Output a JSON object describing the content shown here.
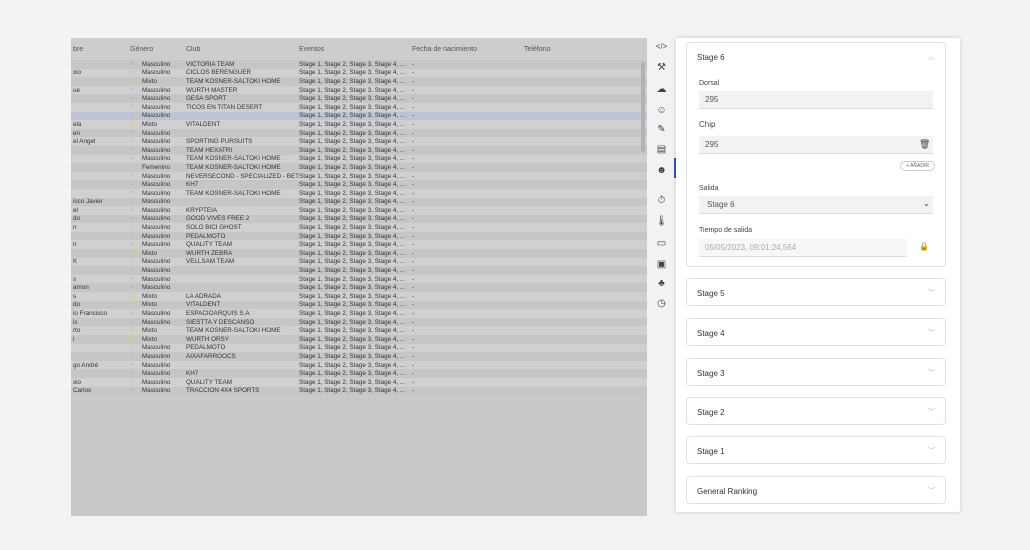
{
  "table": {
    "headers": {
      "name": "bre",
      "gender": "Género",
      "club": "Club",
      "events": "Eventos",
      "birth": "Fecha de nacimiento",
      "phone": "Teléfono"
    },
    "rows": [
      {
        "name": "",
        "g": "♂",
        "gender": "Masculino",
        "club": "VICTORIA TEAM",
        "events": "Stage 1, Stage 2, Stage 3, Stage 4, ...",
        "birth": "-"
      },
      {
        "name": "xio",
        "g": "♂",
        "gender": "Masculino",
        "club": "CICLOS BERENGUER",
        "events": "Stage 1, Stage 2, Stage 3, Stage 4, ...",
        "birth": "-"
      },
      {
        "name": "",
        "g": "⚥",
        "gender": "Mixto",
        "club": "TEAM KOSNER-SALTOKI HOME",
        "events": "Stage 1, Stage 2, Stage 3, Stage 4, ...",
        "birth": "-"
      },
      {
        "name": "ue",
        "g": "♂",
        "gender": "Masculino",
        "club": "WÜRTH MASTER",
        "events": "Stage 1, Stage 2, Stage 3, Stage 4, ...",
        "birth": "-"
      },
      {
        "name": "",
        "g": "♂",
        "gender": "Masculino",
        "club": "GESA SPORT",
        "events": "Stage 1, Stage 2, Stage 3, Stage 4, ...",
        "birth": "-"
      },
      {
        "name": "",
        "g": "♂",
        "gender": "Masculino",
        "club": "TICOS EN TITAN DESERT",
        "events": "Stage 1, Stage 2, Stage 3, Stage 4, ...",
        "birth": "-"
      },
      {
        "name": "",
        "g": "♂",
        "gender": "Masculino",
        "club": "",
        "events": "Stage 1, Stage 2, Stage 3, Stage 4, ...",
        "birth": "-",
        "sel": true
      },
      {
        "name": "ela",
        "g": "⚥",
        "gender": "Mixto",
        "club": "VITALDENT",
        "events": "Stage 1, Stage 2, Stage 3, Stage 4, ...",
        "birth": "-"
      },
      {
        "name": "en",
        "g": "♂",
        "gender": "Masculino",
        "club": "",
        "events": "Stage 1, Stage 2, Stage 3, Stage 4, ...",
        "birth": "-"
      },
      {
        "name": "el Angel",
        "g": "♂",
        "gender": "Masculino",
        "club": "SPORTING PURSUITS",
        "events": "Stage 1, Stage 2, Stage 3, Stage 4, ...",
        "birth": "-"
      },
      {
        "name": "",
        "g": "♂",
        "gender": "Masculino",
        "club": "TEAM HEXATRI",
        "events": "Stage 1, Stage 2, Stage 3, Stage 4, ...",
        "birth": "-"
      },
      {
        "name": "",
        "g": "♂",
        "gender": "Masculino",
        "club": "TEAM KOSNER-SALTOKI HOME",
        "events": "Stage 1, Stage 2, Stage 3, Stage 4, ...",
        "birth": "-"
      },
      {
        "name": "",
        "g": "♀",
        "gender": "Femenino",
        "club": "TEAM KOSNER-SALTOKI HOME",
        "events": "Stage 1, Stage 2, Stage 3, Stage 4, ...",
        "birth": "-"
      },
      {
        "name": "",
        "g": "♂",
        "gender": "Masculino",
        "club": "NEVERSECOND - SPECIALIZED - BET",
        "events": "Stage 1, Stage 2, Stage 3, Stage 4, ...",
        "birth": "-"
      },
      {
        "name": "",
        "g": "♂",
        "gender": "Masculino",
        "club": "KH7",
        "events": "Stage 1, Stage 2, Stage 3, Stage 4, ...",
        "birth": "-"
      },
      {
        "name": "",
        "g": "♂",
        "gender": "Masculino",
        "club": "TEAM KOSNER-SALTOKI HOME",
        "events": "Stage 1, Stage 2, Stage 3, Stage 4, ...",
        "birth": "-"
      },
      {
        "name": "isco Javier",
        "g": "♂",
        "gender": "Masculino",
        "club": "",
        "events": "Stage 1, Stage 2, Stage 3, Stage 4, ...",
        "birth": "-"
      },
      {
        "name": "el",
        "g": "♂",
        "gender": "Masculino",
        "club": "KRYPTEIA",
        "events": "Stage 1, Stage 2, Stage 3, Stage 4, ...",
        "birth": "-"
      },
      {
        "name": "do",
        "g": "♂",
        "gender": "Masculino",
        "club": "GOOD VIVES FREE 2",
        "events": "Stage 1, Stage 2, Stage 3, Stage 4, ...",
        "birth": "-"
      },
      {
        "name": "n",
        "g": "♂",
        "gender": "Masculino",
        "club": "SOLO BICI GHOST",
        "events": "Stage 1, Stage 2, Stage 3, Stage 4, ...",
        "birth": "-"
      },
      {
        "name": "",
        "g": "♂",
        "gender": "Masculino",
        "club": "PEDALMOTO",
        "events": "Stage 1, Stage 2, Stage 3, Stage 4, ...",
        "birth": "-"
      },
      {
        "name": "n",
        "g": "♂",
        "gender": "Masculino",
        "club": "QUALITY TEAM",
        "events": "Stage 1, Stage 2, Stage 3, Stage 4, ...",
        "birth": "-"
      },
      {
        "name": "",
        "g": "⚥",
        "gender": "Mixto",
        "club": "WÜRTH ZEBRA",
        "events": "Stage 1, Stage 2, Stage 3, Stage 4, ...",
        "birth": "-"
      },
      {
        "name": "K",
        "g": "♂",
        "gender": "Masculino",
        "club": "VELLSAM TEAM",
        "events": "Stage 1, Stage 2, Stage 3, Stage 4, ...",
        "birth": "-"
      },
      {
        "name": "",
        "g": "♂",
        "gender": "Masculino",
        "club": "",
        "events": "Stage 1, Stage 2, Stage 3, Stage 4, ...",
        "birth": "-"
      },
      {
        "name": "s",
        "g": "♂",
        "gender": "Masculino",
        "club": "",
        "events": "Stage 1, Stage 2, Stage 3, Stage 4, ...",
        "birth": "-"
      },
      {
        "name": "amon",
        "g": "♂",
        "gender": "Masculino",
        "club": "",
        "events": "Stage 1, Stage 2, Stage 3, Stage 4, ...",
        "birth": "-"
      },
      {
        "name": "s",
        "g": "⚥",
        "gender": "Mixto",
        "club": "LA ADRADA",
        "events": "Stage 1, Stage 2, Stage 3, Stage 4, ...",
        "birth": "-"
      },
      {
        "name": "do",
        "g": "⚥",
        "gender": "Mixto",
        "club": "VITALDENT",
        "events": "Stage 1, Stage 2, Stage 3, Stage 4, ...",
        "birth": "-"
      },
      {
        "name": "io Francisco",
        "g": "♂",
        "gender": "Masculino",
        "club": "ESPACIOARQUIS S.A",
        "events": "Stage 1, Stage 2, Stage 3, Stage 4, ...",
        "birth": "-"
      },
      {
        "name": "is",
        "g": "♂",
        "gender": "Masculino",
        "club": "SIESTTA Y DESCANSO",
        "events": "Stage 1, Stage 2, Stage 3, Stage 4, ...",
        "birth": "-"
      },
      {
        "name": "rto",
        "g": "⚥",
        "gender": "Mixto",
        "club": "TEAM KOSNER-SALTOKI HOME",
        "events": "Stage 1, Stage 2, Stage 3, Stage 4, ...",
        "birth": "-"
      },
      {
        "name": "i",
        "g": "⚥",
        "gender": "Mixto",
        "club": "WÜRTH ORSY",
        "events": "Stage 1, Stage 2, Stage 3, Stage 4, ...",
        "birth": "-"
      },
      {
        "name": "",
        "g": "♂",
        "gender": "Masculino",
        "club": "PEDALMOTO",
        "events": "Stage 1, Stage 2, Stage 3, Stage 4, ...",
        "birth": "-"
      },
      {
        "name": "",
        "g": "♂",
        "gender": "Masculino",
        "club": "AIXAFARROOCS",
        "events": "Stage 1, Stage 2, Stage 3, Stage 4, ...",
        "birth": "-"
      },
      {
        "name": "go André",
        "g": "♂",
        "gender": "Masculino",
        "club": "",
        "events": "Stage 1, Stage 2, Stage 3, Stage 4, ...",
        "birth": "-"
      },
      {
        "name": "",
        "g": "♂",
        "gender": "Masculino",
        "club": "KH7",
        "events": "Stage 1, Stage 2, Stage 3, Stage 4, ...",
        "birth": "-"
      },
      {
        "name": "xio",
        "g": "♂",
        "gender": "Masculino",
        "club": "QUALITY TEAM",
        "events": "Stage 1, Stage 2, Stage 3, Stage 4, ...",
        "birth": "-"
      },
      {
        "name": "Carlos",
        "g": "♂",
        "gender": "Masculino",
        "club": "TRACCIÓN 4X4 SPORTS",
        "events": "Stage 1, Stage 2, Stage 3, Stage 4, ...",
        "birth": "-"
      }
    ]
  },
  "rail": {
    "icons": [
      {
        "name": "code-icon",
        "glyph": "</>"
      },
      {
        "name": "wrench-icon",
        "glyph": "⚒"
      },
      {
        "name": "cloud-upload-icon",
        "glyph": "☁"
      },
      {
        "name": "add-user-icon",
        "glyph": "☺"
      },
      {
        "name": "edit-icon",
        "glyph": "✎"
      },
      {
        "name": "clipboard-icon",
        "glyph": "▤"
      },
      {
        "name": "users-icon",
        "glyph": "☻"
      },
      {
        "name": "stopwatch-icon",
        "glyph": "⏱"
      },
      {
        "name": "thermometer-icon",
        "glyph": "🌡"
      },
      {
        "name": "laptop-icon",
        "glyph": "▭"
      },
      {
        "name": "document-icon",
        "glyph": "▣"
      },
      {
        "name": "group-icon",
        "glyph": "♣"
      },
      {
        "name": "timer-icon",
        "glyph": "◷"
      }
    ]
  },
  "panel": {
    "expanded": {
      "title": "Stage 6",
      "dorsal_label": "Dorsal",
      "dorsal_value": "295",
      "chip_label": "Chip",
      "chip_value": "295",
      "add_label": "+ AÑADIR",
      "salida_label": "Salida",
      "salida_value": "Stage 6",
      "tiempo_label": "Tiempo de salida",
      "tiempo_value": "05/05/2023, 09:01:24,564"
    },
    "collapsed": [
      "Stage 5",
      "Stage 4",
      "Stage 3",
      "Stage 2",
      "Stage 1",
      "General Ranking"
    ]
  }
}
